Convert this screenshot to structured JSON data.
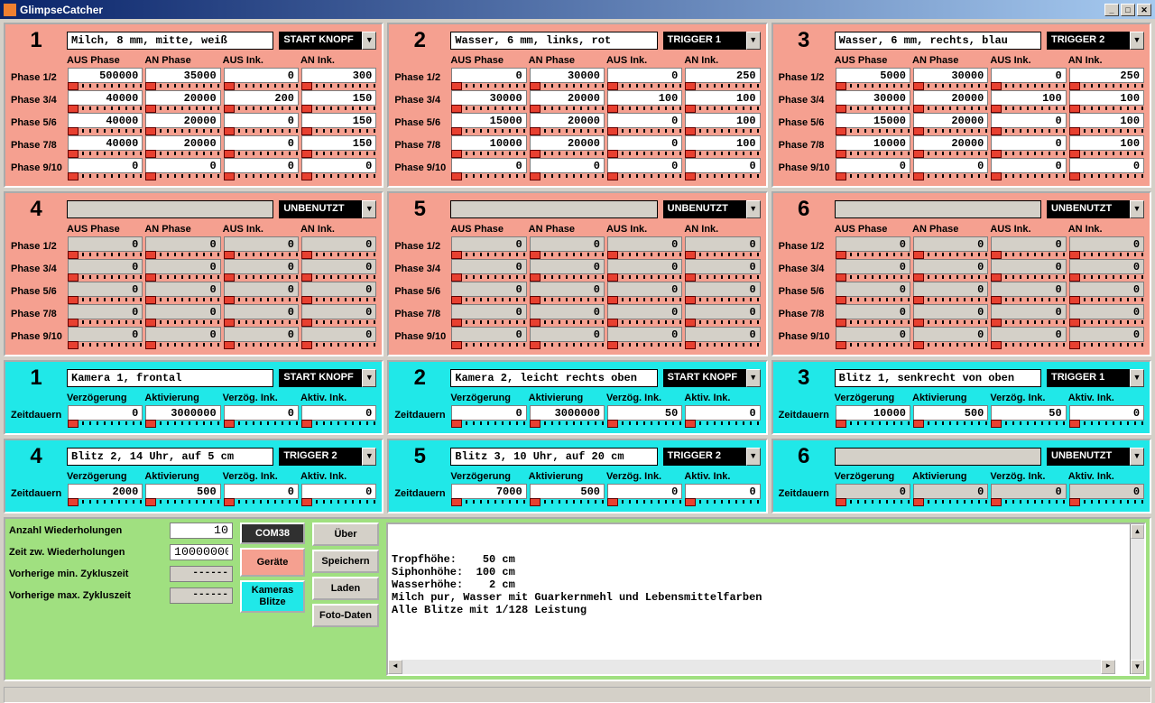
{
  "title": "GlimpseCatcher",
  "win_btns": {
    "min": "_",
    "max": "□",
    "close": "✕"
  },
  "device_headers": [
    "AUS Phase",
    "AN Phase",
    "AUS Ink.",
    "AN Ink."
  ],
  "phase_row_labels": [
    "Phase 1/2",
    "Phase 3/4",
    "Phase 5/6",
    "Phase 7/8",
    "Phase 9/10"
  ],
  "combo_arrow": "▼",
  "devices": [
    {
      "num": "1",
      "desc": "Milch, 8 mm, mitte, weiß",
      "trigger": "START KNOPF",
      "enabled": true,
      "rows": [
        [
          "500000",
          "35000",
          "0",
          "300"
        ],
        [
          "40000",
          "20000",
          "200",
          "150"
        ],
        [
          "40000",
          "20000",
          "0",
          "150"
        ],
        [
          "40000",
          "20000",
          "0",
          "150"
        ],
        [
          "0",
          "0",
          "0",
          "0"
        ]
      ]
    },
    {
      "num": "2",
      "desc": "Wasser, 6 mm, links, rot",
      "trigger": "TRIGGER 1",
      "enabled": true,
      "rows": [
        [
          "0",
          "30000",
          "0",
          "250"
        ],
        [
          "30000",
          "20000",
          "100",
          "100"
        ],
        [
          "15000",
          "20000",
          "0",
          "100"
        ],
        [
          "10000",
          "20000",
          "0",
          "100"
        ],
        [
          "0",
          "0",
          "0",
          "0"
        ]
      ]
    },
    {
      "num": "3",
      "desc": "Wasser, 6 mm, rechts, blau",
      "trigger": "TRIGGER 2",
      "enabled": true,
      "rows": [
        [
          "5000",
          "30000",
          "0",
          "250"
        ],
        [
          "30000",
          "20000",
          "100",
          "100"
        ],
        [
          "15000",
          "20000",
          "0",
          "100"
        ],
        [
          "10000",
          "20000",
          "0",
          "100"
        ],
        [
          "0",
          "0",
          "0",
          "0"
        ]
      ]
    },
    {
      "num": "4",
      "desc": "",
      "trigger": "UNBENUTZT",
      "enabled": false,
      "rows": [
        [
          "0",
          "0",
          "0",
          "0"
        ],
        [
          "0",
          "0",
          "0",
          "0"
        ],
        [
          "0",
          "0",
          "0",
          "0"
        ],
        [
          "0",
          "0",
          "0",
          "0"
        ],
        [
          "0",
          "0",
          "0",
          "0"
        ]
      ]
    },
    {
      "num": "5",
      "desc": "",
      "trigger": "UNBENUTZT",
      "enabled": false,
      "rows": [
        [
          "0",
          "0",
          "0",
          "0"
        ],
        [
          "0",
          "0",
          "0",
          "0"
        ],
        [
          "0",
          "0",
          "0",
          "0"
        ],
        [
          "0",
          "0",
          "0",
          "0"
        ],
        [
          "0",
          "0",
          "0",
          "0"
        ]
      ]
    },
    {
      "num": "6",
      "desc": "",
      "trigger": "UNBENUTZT",
      "enabled": false,
      "rows": [
        [
          "0",
          "0",
          "0",
          "0"
        ],
        [
          "0",
          "0",
          "0",
          "0"
        ],
        [
          "0",
          "0",
          "0",
          "0"
        ],
        [
          "0",
          "0",
          "0",
          "0"
        ],
        [
          "0",
          "0",
          "0",
          "0"
        ]
      ]
    }
  ],
  "camera_headers": [
    "Verzögerung",
    "Aktivierung",
    "Verzög. Ink.",
    "Aktiv. Ink."
  ],
  "camera_row_label": "Zeitdauern",
  "cameras": [
    {
      "num": "1",
      "desc": "Kamera 1, frontal",
      "trigger": "START KNOPF",
      "enabled": true,
      "row": [
        "0",
        "3000000",
        "0",
        "0"
      ]
    },
    {
      "num": "2",
      "desc": "Kamera 2, leicht rechts oben",
      "trigger": "START KNOPF",
      "enabled": true,
      "row": [
        "0",
        "3000000",
        "50",
        "0"
      ]
    },
    {
      "num": "3",
      "desc": "Blitz 1, senkrecht von oben",
      "trigger": "TRIGGER 1",
      "enabled": true,
      "row": [
        "10000",
        "500",
        "50",
        "0"
      ]
    },
    {
      "num": "4",
      "desc": "Blitz 2, 14 Uhr, auf 5 cm",
      "trigger": "TRIGGER 2",
      "enabled": true,
      "row": [
        "2000",
        "500",
        "0",
        "0"
      ]
    },
    {
      "num": "5",
      "desc": "Blitz 3, 10 Uhr, auf 20 cm",
      "trigger": "TRIGGER 2",
      "enabled": true,
      "row": [
        "7000",
        "500",
        "0",
        "0"
      ]
    },
    {
      "num": "6",
      "desc": "",
      "trigger": "UNBENUTZT",
      "enabled": false,
      "row": [
        "0",
        "0",
        "0",
        "0"
      ]
    }
  ],
  "bottom": {
    "repeat_count_label": "Anzahl Wiederholungen",
    "repeat_count": "10",
    "repeat_time_label": "Zeit zw. Wiederholungen",
    "repeat_time": "10000000",
    "prev_min_label": "Vorherige min. Zykluszeit",
    "prev_min": "------",
    "prev_max_label": "Vorherige max. Zykluszeit",
    "prev_max": "------",
    "com_label": "COM38",
    "geraete": "Geräte",
    "kameras": "Kameras\nBlitze",
    "ueber": "Über",
    "speichern": "Speichern",
    "laden": "Laden",
    "fotodaten": "Foto-Daten",
    "notes": "Tropfhöhe:    50 cm\nSiphonhöhe:  100 cm\nWasserhöhe:    2 cm\nMilch pur, Wasser mit Guarkernmehl und Lebensmittelfarben\nAlle Blitze mit 1/128 Leistung"
  }
}
